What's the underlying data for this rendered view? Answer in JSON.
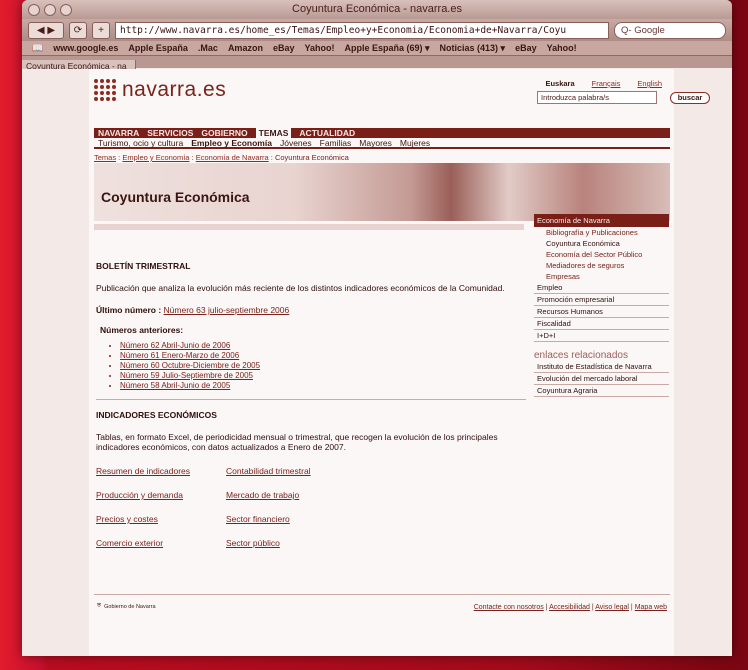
{
  "window": {
    "title": "Coyuntura Económica - navarra.es"
  },
  "toolbar": {
    "url": "http://www.navarra.es/home_es/Temas/Empleo+y+Economia/Economia+de+Navarra/Coyu",
    "search_placeholder": "Q- Google"
  },
  "bookmarks": [
    "www.google.es",
    "Apple España",
    ".Mac",
    "Amazon",
    "eBay",
    "Yahoo!",
    "Apple España (69) ▾",
    "Noticias (413) ▾",
    "eBay",
    "Yahoo!"
  ],
  "tab": {
    "label": "Coyuntura Económica - na"
  },
  "site": {
    "logo": "navarra.es",
    "languages": [
      "Euskara",
      "Français",
      "English"
    ],
    "search": {
      "value": "Introduzca palabra/s",
      "button": "buscar"
    },
    "nav1": [
      "NAVARRA",
      "SERVICIOS",
      "GOBIERNO",
      "TEMAS",
      "ACTUALIDAD"
    ],
    "nav1_active": "TEMAS",
    "nav2": [
      "Turismo, ocio y cultura",
      "Empleo y Economía",
      "Jóvenes",
      "Familias",
      "Mayores",
      "Mujeres"
    ],
    "breadcrumb": {
      "l1": "Temas",
      "sep": " : ",
      "l2": "Empleo y Economía",
      "l3": "Economía de Navarra",
      "l4": "Coyuntura Económica"
    },
    "page_title": "Coyuntura Económica"
  },
  "main": {
    "boletin_title": "BOLETÍN TRIMESTRAL",
    "boletin_text": "Publicación que analiza la evolución más reciente de los distintos indicadores económicos de la Comunidad.",
    "ultimo_label": "Último número :",
    "ultimo_link": "Número 63 julio-septiembre 2006",
    "anteriores_label": "Números anteriores:",
    "anteriores": [
      "Número 62 Abril-Junio de 2006",
      "Número 61 Enero-Marzo de 2006",
      "Número 60 Octubre-Diciembre de 2005",
      "Número 59 Julio-Septiembre de 2005",
      "Número 58 Abril-Junio de 2005"
    ],
    "indicadores_title": "INDICADORES ECONÓMICOS",
    "indicadores_text": "Tablas, en formato Excel, de periodicidad mensual o trimestral, que recogen la evolución de los principales indicadores económicos, con datos actualizados a Enero de 2007.",
    "links": [
      "Resumen de indicadores",
      "Contabilidad trimestral",
      "Producción y demanda",
      "Mercado de trabajo",
      "Precios y costes",
      "Sector financiero",
      "Comercio exterior",
      "Sector público"
    ]
  },
  "sidebar": {
    "head": "Economía de Navarra",
    "sub": [
      "Bibliografía y Publicaciones",
      "Coyuntura Económica",
      "Economía del Sector Público",
      "Mediadores de seguros",
      "Empresas"
    ],
    "items": [
      "Empleo",
      "Promoción empresarial",
      "Recursos Humanos",
      "Fiscalidad",
      "I+D+I"
    ],
    "related_title": "enlaces relacionados",
    "related": [
      "Instituto de Estadística de Navarra",
      "Evolución del mercado laboral",
      "Coyuntura Agraria"
    ]
  },
  "footer": {
    "logo": "Gobierno de Navarra",
    "links": [
      "Contacte con nosotros",
      "Accesibilidad",
      "Aviso legal",
      "Mapa web"
    ]
  }
}
